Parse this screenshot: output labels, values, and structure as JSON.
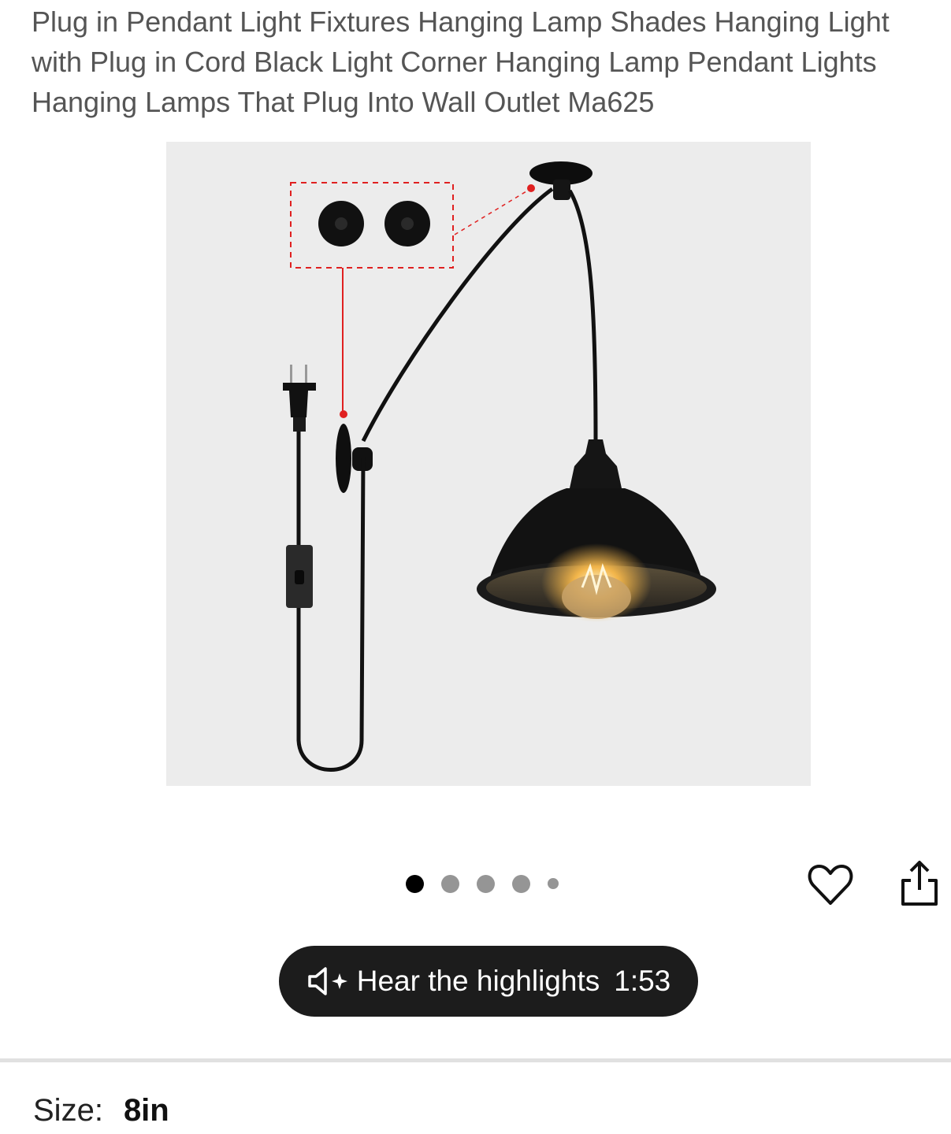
{
  "product": {
    "title": "Plug in Pendant Light Fixtures Hanging Lamp Shades Hanging Light with Plug in Cord Black Light Corner Hanging Lamp Pendant Lights Hanging Lamps That Plug Into Wall Outlet Ma625"
  },
  "gallery": {
    "image_count": 5,
    "active_index": 0
  },
  "actions": {
    "favorite_icon": "heart-outline-icon",
    "share_icon": "share-icon"
  },
  "audio": {
    "label": "Hear the highlights",
    "duration": "1:53"
  },
  "size": {
    "label": "Size:",
    "value": "8in"
  },
  "colors": {
    "accent_dark": "#1c1c1c",
    "dot_inactive": "#959595",
    "dot_active": "#000000",
    "annotation_red": "#e02020"
  }
}
